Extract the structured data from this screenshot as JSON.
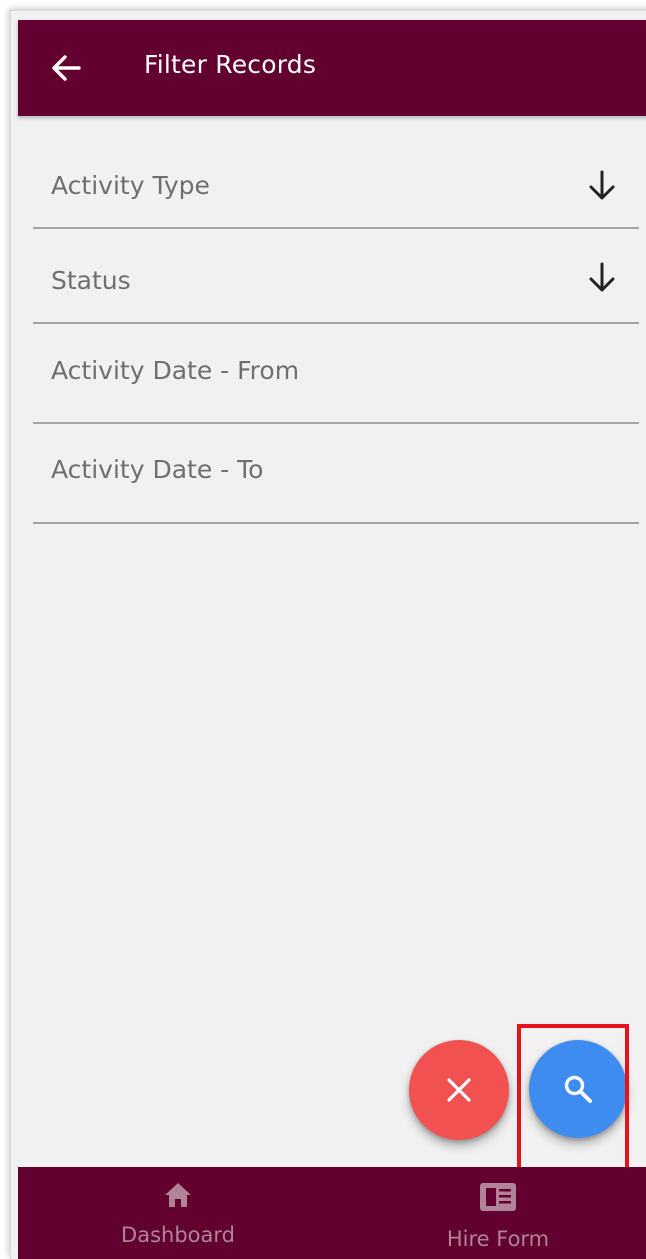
{
  "app_bar": {
    "title": "Filter Records",
    "back_icon": "arrow-left-icon"
  },
  "fields": {
    "activity_type": {
      "label": "Activity Type",
      "icon": "arrow-down-icon"
    },
    "status": {
      "label": "Status",
      "icon": "arrow-down-icon"
    },
    "date_from": {
      "label": "Activity Date - From"
    },
    "date_to": {
      "label": "Activity Date - To"
    }
  },
  "actions": {
    "clear_icon": "close-icon",
    "search_icon": "search-icon"
  },
  "bottom_nav": {
    "items": [
      {
        "label": "Dashboard",
        "icon": "home-icon"
      },
      {
        "label": "Hire Form",
        "icon": "form-icon"
      }
    ]
  },
  "colors": {
    "primary": "#620030",
    "background": "#f1f1f1",
    "clear_button": "#f25151",
    "search_button": "#3f8cf0",
    "highlight": "#e8121d"
  }
}
